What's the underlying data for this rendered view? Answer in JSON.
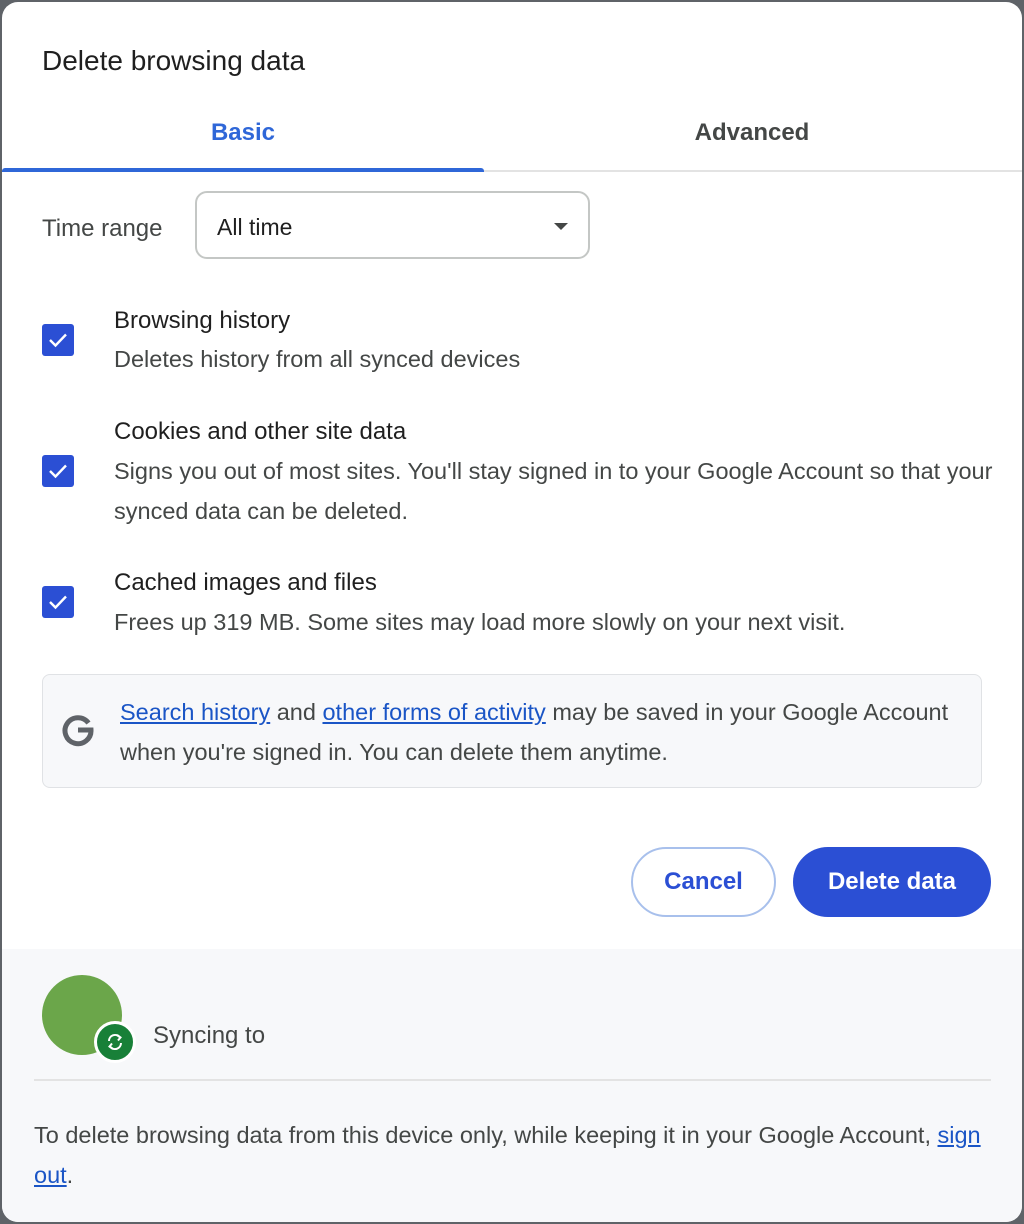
{
  "dialog": {
    "title": "Delete browsing data",
    "tabs": [
      {
        "label": "Basic",
        "selected": true
      },
      {
        "label": "Advanced",
        "selected": false
      }
    ],
    "time_range": {
      "label": "Time range",
      "value": "All time"
    },
    "options": [
      {
        "title": "Browsing history",
        "description": "Deletes history from all synced devices",
        "checked": true
      },
      {
        "title": "Cookies and other site data",
        "description": "Signs you out of most sites. You'll stay signed in to your Google Account so that your synced data can be deleted.",
        "checked": true
      },
      {
        "title": "Cached images and files",
        "description": "Frees up 319 MB. Some sites may load more slowly on your next visit.",
        "checked": true
      }
    ],
    "info": {
      "icon": "google-g-icon",
      "link1": "Search history",
      "text1": " and ",
      "link2": "other forms of activity",
      "text2": " may be saved in your Google Account when you're signed in. You can delete them anytime."
    },
    "buttons": {
      "cancel": "Cancel",
      "delete": "Delete data"
    },
    "footer": {
      "sync_label": "Syncing to",
      "note_text": "To delete browsing data from this device only, while keeping it in your Google Account, ",
      "note_link": "sign out",
      "note_end": "."
    }
  },
  "colors": {
    "accent": "#2b4fd4",
    "tab_selected": "#2f67d8",
    "link": "#1a55c6",
    "avatar": "#6ba64a",
    "sync_badge": "#188038"
  }
}
